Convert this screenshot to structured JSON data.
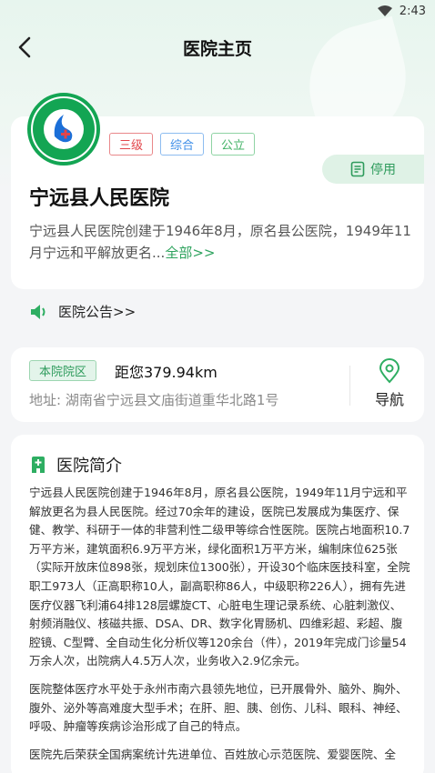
{
  "status": {
    "time": "2:43"
  },
  "nav": {
    "title": "医院主页"
  },
  "hospital": {
    "tags": [
      "三级",
      "综合",
      "公立"
    ],
    "stop_label": "停用",
    "name": "宁远县人民医院",
    "summary": "宁远县人民医院创建于1946年8月，原名县公医院，1949年11月宁远和平解放更名...",
    "more_label": "全部>>",
    "logo_text": "宁远县人民医院",
    "colors": {
      "accent": "#13a553",
      "tag_red": "#e2454a",
      "tag_blue": "#3d8ee8",
      "tag_green": "#42b266"
    }
  },
  "notice": {
    "label": "医院公告>>"
  },
  "campus": {
    "tag": "本院院区",
    "distance": "距您379.94km",
    "address": "地址: 湖南省宁远县文庙街道重华北路1号",
    "nav_label": "导航"
  },
  "intro": {
    "title": "医院简介",
    "paragraphs": [
      "宁远县人民医院创建于1946年8月，原名县公医院，1949年11月宁远和平解放更名为县人民医院。经过70余年的建设，医院已发展成为集医疗、保健、教学、科研于一体的非营利性二级甲等综合性医院。医院占地面积10.7万平方米，建筑面积6.9万平方米，绿化面积1万平方米，编制床位625张（实际开放床位898张，规划床位1300张），开设30个临床医技科室，全院职工973人（正高职称10人，副高职称86人，中级职称226人），拥有先进医疗仪器飞利浦64排128层螺旋CT、心脏电生理记录系统、心脏刺激仪、射频消融仪、核磁共振、DSA、DR、数字化胃肠机、四维彩超、彩超、腹腔镜、C型臂、全自动生化分析仪等120余台（件），2019年完成门诊量54万余人次，出院病人4.5万人次，业务收入2.9亿余元。",
      "医院整体医疗水平处于永州市南六县领先地位，已开展骨外、脑外、胸外、腹外、泌外等高难度大型手术；在肝、胆、胰、创伤、儿科、眼科、神经、呼吸、肿瘤等疾病诊治形成了自己的特点。",
      "医院先后荣获全国病案统计先进单位、百姓放心示范医院、爱婴医院、全"
    ]
  }
}
